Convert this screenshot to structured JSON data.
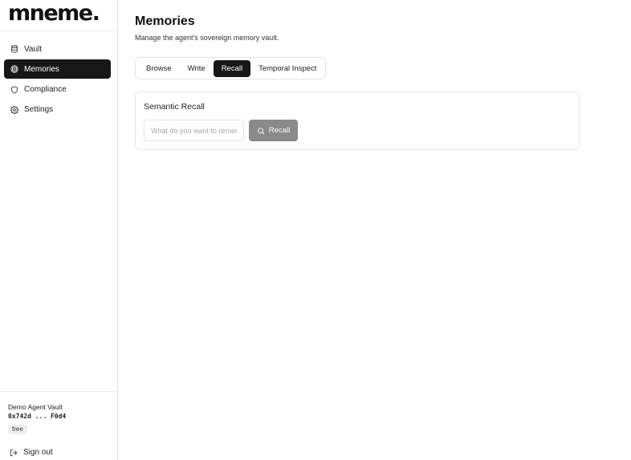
{
  "app": {
    "logo": "mneme."
  },
  "sidebar": {
    "items": [
      {
        "label": "Vault",
        "icon": "database-icon",
        "active": false
      },
      {
        "label": "Memories",
        "icon": "brain-icon",
        "active": true
      },
      {
        "label": "Compliance",
        "icon": "shield-icon",
        "active": false
      },
      {
        "label": "Settings",
        "icon": "gear-icon",
        "active": false
      }
    ],
    "footer": {
      "vault_name": "Demo Agent Vault",
      "vault_address": "0x742d ... F0d4",
      "plan": "free",
      "signout_label": "Sign out"
    }
  },
  "page": {
    "title": "Memories",
    "subtitle": "Manage the agent's sovereign memory vault."
  },
  "tabs": [
    {
      "label": "Browse",
      "active": false
    },
    {
      "label": "Write",
      "active": false
    },
    {
      "label": "Recall",
      "active": true
    },
    {
      "label": "Temporal Inspect",
      "active": false
    }
  ],
  "recall": {
    "title": "Semantic Recall",
    "input_value": "",
    "placeholder": "What do you want to remember?",
    "button_label": "Recall"
  },
  "colors": {
    "active_nav_bg": "#171717",
    "button_bg": "#8a8a8a",
    "border": "#e6e6e6"
  }
}
